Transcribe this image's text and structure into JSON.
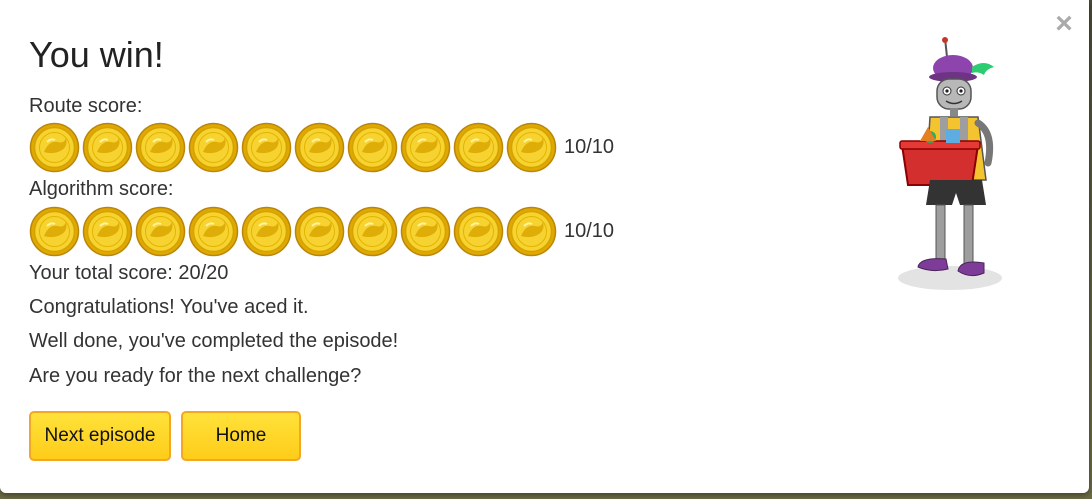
{
  "dialog": {
    "title": "You win!",
    "close_icon": "close-icon"
  },
  "route": {
    "label": "Route score:",
    "coins": 10,
    "score_text": "10/10"
  },
  "algorithm": {
    "label": "Algorithm score:",
    "coins": 10,
    "score_text": "10/10"
  },
  "messages": {
    "total": "Your total score: 20/20",
    "congrats": "Congratulations! You've aced it.",
    "done": "Well done, you've completed the episode!",
    "ready": "Are you ready for the next challenge?"
  },
  "buttons": {
    "next_label": "Next episode",
    "home_label": "Home"
  },
  "colors": {
    "button_fill": "#ffd824",
    "button_border": "#f5a623",
    "coin_gold": "#f2c418"
  }
}
